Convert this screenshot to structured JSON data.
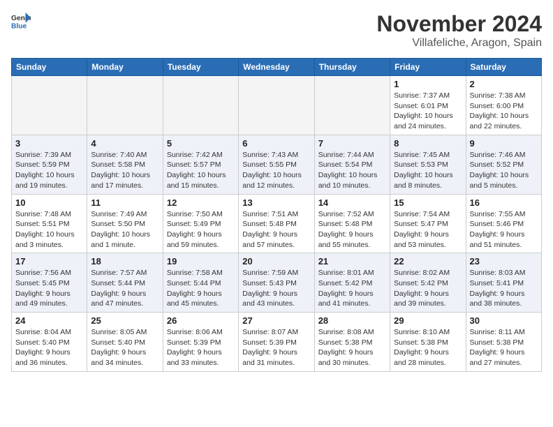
{
  "header": {
    "logo_line1": "General",
    "logo_line2": "Blue",
    "month": "November 2024",
    "location": "Villafeliche, Aragon, Spain"
  },
  "days_of_week": [
    "Sunday",
    "Monday",
    "Tuesday",
    "Wednesday",
    "Thursday",
    "Friday",
    "Saturday"
  ],
  "weeks": [
    [
      {
        "day": "",
        "info": ""
      },
      {
        "day": "",
        "info": ""
      },
      {
        "day": "",
        "info": ""
      },
      {
        "day": "",
        "info": ""
      },
      {
        "day": "",
        "info": ""
      },
      {
        "day": "1",
        "info": "Sunrise: 7:37 AM\nSunset: 6:01 PM\nDaylight: 10 hours and 24 minutes."
      },
      {
        "day": "2",
        "info": "Sunrise: 7:38 AM\nSunset: 6:00 PM\nDaylight: 10 hours and 22 minutes."
      }
    ],
    [
      {
        "day": "3",
        "info": "Sunrise: 7:39 AM\nSunset: 5:59 PM\nDaylight: 10 hours and 19 minutes."
      },
      {
        "day": "4",
        "info": "Sunrise: 7:40 AM\nSunset: 5:58 PM\nDaylight: 10 hours and 17 minutes."
      },
      {
        "day": "5",
        "info": "Sunrise: 7:42 AM\nSunset: 5:57 PM\nDaylight: 10 hours and 15 minutes."
      },
      {
        "day": "6",
        "info": "Sunrise: 7:43 AM\nSunset: 5:55 PM\nDaylight: 10 hours and 12 minutes."
      },
      {
        "day": "7",
        "info": "Sunrise: 7:44 AM\nSunset: 5:54 PM\nDaylight: 10 hours and 10 minutes."
      },
      {
        "day": "8",
        "info": "Sunrise: 7:45 AM\nSunset: 5:53 PM\nDaylight: 10 hours and 8 minutes."
      },
      {
        "day": "9",
        "info": "Sunrise: 7:46 AM\nSunset: 5:52 PM\nDaylight: 10 hours and 5 minutes."
      }
    ],
    [
      {
        "day": "10",
        "info": "Sunrise: 7:48 AM\nSunset: 5:51 PM\nDaylight: 10 hours and 3 minutes."
      },
      {
        "day": "11",
        "info": "Sunrise: 7:49 AM\nSunset: 5:50 PM\nDaylight: 10 hours and 1 minute."
      },
      {
        "day": "12",
        "info": "Sunrise: 7:50 AM\nSunset: 5:49 PM\nDaylight: 9 hours and 59 minutes."
      },
      {
        "day": "13",
        "info": "Sunrise: 7:51 AM\nSunset: 5:48 PM\nDaylight: 9 hours and 57 minutes."
      },
      {
        "day": "14",
        "info": "Sunrise: 7:52 AM\nSunset: 5:48 PM\nDaylight: 9 hours and 55 minutes."
      },
      {
        "day": "15",
        "info": "Sunrise: 7:54 AM\nSunset: 5:47 PM\nDaylight: 9 hours and 53 minutes."
      },
      {
        "day": "16",
        "info": "Sunrise: 7:55 AM\nSunset: 5:46 PM\nDaylight: 9 hours and 51 minutes."
      }
    ],
    [
      {
        "day": "17",
        "info": "Sunrise: 7:56 AM\nSunset: 5:45 PM\nDaylight: 9 hours and 49 minutes."
      },
      {
        "day": "18",
        "info": "Sunrise: 7:57 AM\nSunset: 5:44 PM\nDaylight: 9 hours and 47 minutes."
      },
      {
        "day": "19",
        "info": "Sunrise: 7:58 AM\nSunset: 5:44 PM\nDaylight: 9 hours and 45 minutes."
      },
      {
        "day": "20",
        "info": "Sunrise: 7:59 AM\nSunset: 5:43 PM\nDaylight: 9 hours and 43 minutes."
      },
      {
        "day": "21",
        "info": "Sunrise: 8:01 AM\nSunset: 5:42 PM\nDaylight: 9 hours and 41 minutes."
      },
      {
        "day": "22",
        "info": "Sunrise: 8:02 AM\nSunset: 5:42 PM\nDaylight: 9 hours and 39 minutes."
      },
      {
        "day": "23",
        "info": "Sunrise: 8:03 AM\nSunset: 5:41 PM\nDaylight: 9 hours and 38 minutes."
      }
    ],
    [
      {
        "day": "24",
        "info": "Sunrise: 8:04 AM\nSunset: 5:40 PM\nDaylight: 9 hours and 36 minutes."
      },
      {
        "day": "25",
        "info": "Sunrise: 8:05 AM\nSunset: 5:40 PM\nDaylight: 9 hours and 34 minutes."
      },
      {
        "day": "26",
        "info": "Sunrise: 8:06 AM\nSunset: 5:39 PM\nDaylight: 9 hours and 33 minutes."
      },
      {
        "day": "27",
        "info": "Sunrise: 8:07 AM\nSunset: 5:39 PM\nDaylight: 9 hours and 31 minutes."
      },
      {
        "day": "28",
        "info": "Sunrise: 8:08 AM\nSunset: 5:38 PM\nDaylight: 9 hours and 30 minutes."
      },
      {
        "day": "29",
        "info": "Sunrise: 8:10 AM\nSunset: 5:38 PM\nDaylight: 9 hours and 28 minutes."
      },
      {
        "day": "30",
        "info": "Sunrise: 8:11 AM\nSunset: 5:38 PM\nDaylight: 9 hours and 27 minutes."
      }
    ]
  ]
}
